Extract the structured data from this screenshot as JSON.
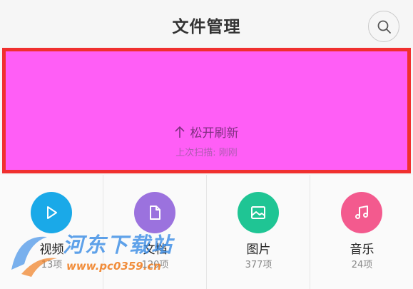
{
  "header": {
    "title": "文件管理",
    "search_icon": "search-icon"
  },
  "refresh": {
    "label": "松开刷新",
    "arrow_icon": "arrow-up-icon",
    "subtext": "上次扫描: 刚刚",
    "panel_color": "#ff5ef6",
    "outline_color": "#f0302f"
  },
  "categories": [
    {
      "name": "视频",
      "count": "13项",
      "icon": "play-icon",
      "color": "#1aa9e8"
    },
    {
      "name": "文档",
      "count": "120项",
      "icon": "document-icon",
      "color": "#9b72de"
    },
    {
      "name": "图片",
      "count": "377项",
      "icon": "image-icon",
      "color": "#1fc594"
    },
    {
      "name": "音乐",
      "count": "24项",
      "icon": "music-note-icon",
      "color": "#f35a8e"
    }
  ],
  "watermark": {
    "main": "河东下载站",
    "url": "www.pc0359.cn"
  }
}
